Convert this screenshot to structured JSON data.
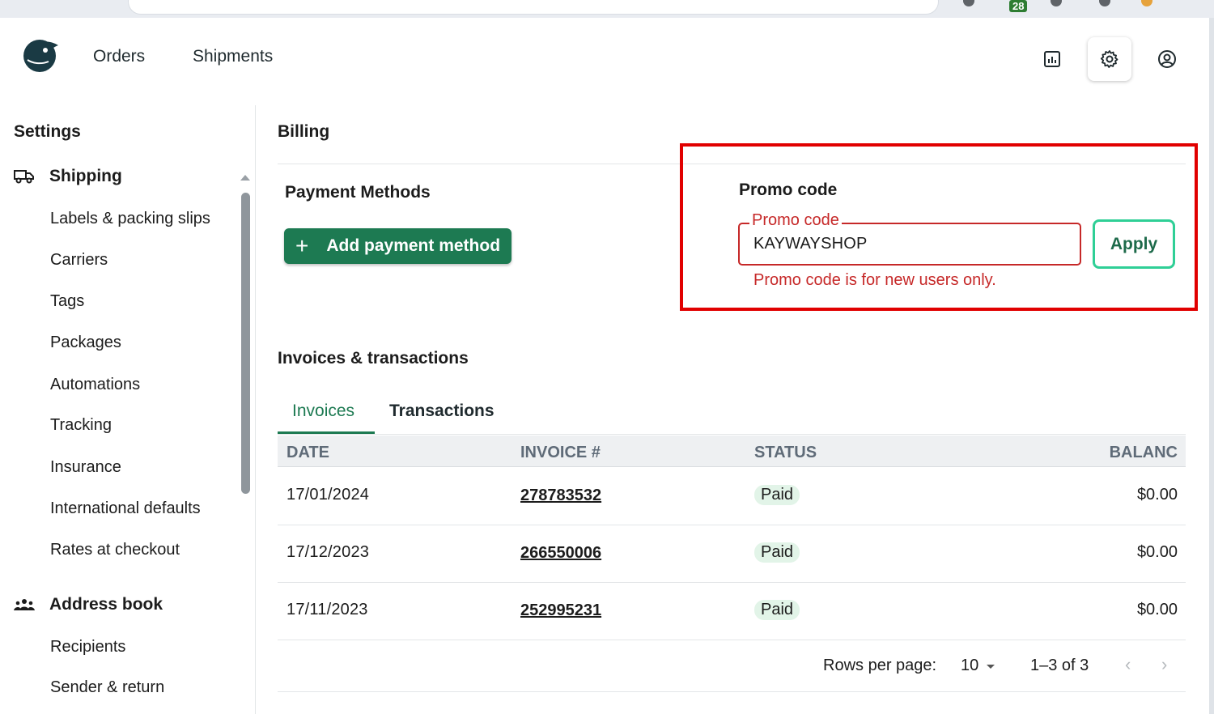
{
  "browser": {
    "tab_badge": "28"
  },
  "nav": {
    "links": [
      "Orders",
      "Shipments"
    ],
    "icons": [
      "reports-icon",
      "settings-gear-icon",
      "account-icon"
    ]
  },
  "sidebar": {
    "title": "Settings",
    "shipping": {
      "label": "Shipping",
      "items": [
        "Labels & packing slips",
        "Carriers",
        "Tags",
        "Packages",
        "Automations",
        "Tracking",
        "Insurance",
        "International defaults",
        "Rates at checkout"
      ]
    },
    "address_book": {
      "label": "Address book",
      "items": [
        "Recipients",
        "Sender & return"
      ]
    }
  },
  "billing": {
    "title": "Billing",
    "payment_methods": {
      "title": "Payment Methods",
      "add_button": "Add payment method",
      "add_icon": "+"
    },
    "promo": {
      "title": "Promo code",
      "field_label": "Promo code",
      "value": "KAYWAYSHOP",
      "error": "Promo code is for new users only.",
      "apply_button": "Apply"
    },
    "highlight_color": "#e10000",
    "accent_color": "#1d7a52"
  },
  "invoices": {
    "title": "Invoices & transactions",
    "tabs": [
      "Invoices",
      "Transactions"
    ],
    "active_tab": "Invoices",
    "columns": [
      "DATE",
      "INVOICE #",
      "STATUS",
      "BALANC"
    ],
    "rows": [
      {
        "date": "17/01/2024",
        "invoice": "278783532",
        "status": "Paid",
        "balance": "$0.00"
      },
      {
        "date": "17/12/2023",
        "invoice": "266550006",
        "status": "Paid",
        "balance": "$0.00"
      },
      {
        "date": "17/11/2023",
        "invoice": "252995231",
        "status": "Paid",
        "balance": "$0.00"
      }
    ],
    "pagination": {
      "rows_per_page_label": "Rows per page:",
      "rows_per_page": "10",
      "range": "1–3 of 3",
      "prev": "‹",
      "next": "›"
    }
  }
}
